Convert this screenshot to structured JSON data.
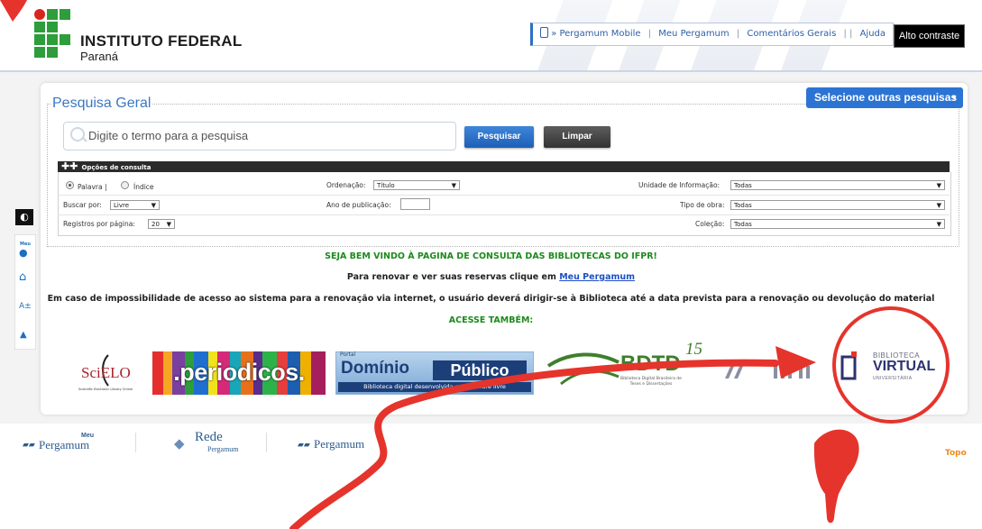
{
  "header": {
    "institution_name": "INSTITUTO FEDERAL",
    "institution_state": "Paraná",
    "links": [
      "» Pergamum Mobile",
      "Meu Pergamum",
      "Comentários Gerais",
      "Ajuda"
    ],
    "contrast_button": "Alto contraste"
  },
  "search": {
    "legend": "Pesquisa Geral",
    "select_other": "Selecione outras pesquisas",
    "placeholder": "Digite o termo para a pesquisa",
    "search_button": "Pesquisar",
    "clear_button": "Limpar",
    "options_title": "Opções de consulta",
    "radio_word": "Palavra |",
    "radio_index": "Índice",
    "order_label": "Ordenação:",
    "order_value": "Título",
    "unit_label": "Unidade de Informação:",
    "unit_value": "Todas",
    "search_by_label": "Buscar por:",
    "search_by_value": "Livre",
    "year_label": "Ano de publicação:",
    "work_type_label": "Tipo de obra:",
    "work_type_value": "Todas",
    "per_page_label": "Registros por página:",
    "per_page_value": "20",
    "collection_label": "Coleção:",
    "collection_value": "Todas"
  },
  "messages": {
    "welcome": "SEJA BEM VINDO À PAGINA DE CONSULTA DAS BIBLIOTECAS DO IFPR!",
    "renew_prefix": "Para renovar e ver suas reservas clique em",
    "renew_link": "Meu Pergamum",
    "notice": "Em caso de impossibilidade de acesso ao sistema para a renovação via internet, o usuário deverá dirigir-se à Biblioteca até a data prevista para a renovação ou devolução do material",
    "also": "ACESSE TAMBÉM:"
  },
  "partners": {
    "scielo": "SciELO",
    "scielo_sub": "Scientific Electronic Library Online",
    "periodicos": ".periodicos.",
    "dominio_portal": "Portal",
    "dominio_title": "Domínio",
    "dominio_publico": "Público",
    "dominio_sub": "Biblioteca digital desenvolvida em software livre",
    "bdtd": "BDTD",
    "bdtd_years": "15",
    "bdtd_sub": "Biblioteca Digital Brasileira de Teses e Dissertações",
    "bv_line1": "BIBLIOTECA",
    "bv_line2": "VIRTUAL",
    "bv_line3": "UNIVERSITÁRIA"
  },
  "side_tools": [
    "contrast-icon",
    "meu-pergamum-icon",
    "home-icon",
    "font-size-icon",
    "scroll-up-icon"
  ],
  "side_labels": {
    "meu": "Meu",
    "font": "A±"
  },
  "footer": {
    "meu": "Meu",
    "logo1": "Pergamum",
    "logo2_line1": "Rede",
    "logo2_line2": "Pergamum",
    "logo3": "Pergamum",
    "top_link": "Topo"
  },
  "colors": {
    "accent_blue": "#2c74d3",
    "if_green": "#2e9d3b",
    "if_red": "#d7261e",
    "annotation_red": "#e5342c",
    "welcome_green": "#1c8a1c",
    "topo_orange": "#f08a1c"
  }
}
